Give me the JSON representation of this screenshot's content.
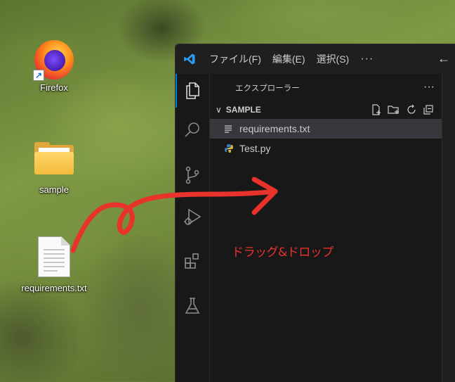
{
  "desktop": {
    "icons": [
      {
        "label": "Firefox",
        "icon": "firefox-icon"
      },
      {
        "label": "sample",
        "icon": "folder-icon"
      },
      {
        "label": "requirements.txt",
        "icon": "text-file-icon"
      }
    ]
  },
  "vscode": {
    "menu": [
      {
        "label": "ファイル(F)"
      },
      {
        "label": "編集(E)"
      },
      {
        "label": "選択(S)"
      },
      {
        "label": "···"
      }
    ],
    "back_icon": "←",
    "explorer": {
      "title": "エクスプローラー",
      "more": "···",
      "section": {
        "chevron": "∨",
        "name": "SAMPLE"
      },
      "files": [
        {
          "name": "requirements.txt",
          "icon": "text-file-icon",
          "selected": true
        },
        {
          "name": "Test.py",
          "icon": "python-icon",
          "selected": false
        }
      ]
    }
  },
  "annotation": {
    "text": "ドラッグ&ドロップ",
    "color": "#e8322c"
  },
  "colors": {
    "editor_bg": "#1f1f1f",
    "sidebar_bg": "#181818",
    "selection": "#37373d",
    "accent": "#0078d4"
  }
}
